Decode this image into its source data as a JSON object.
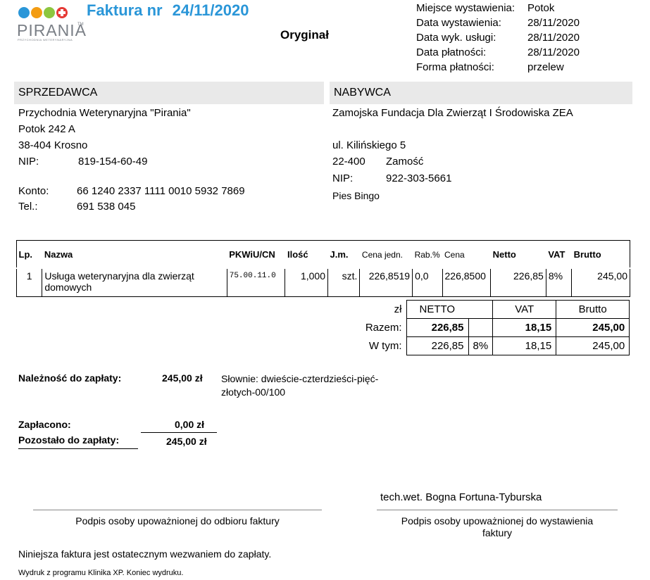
{
  "logo": {
    "word": "PIRANIA",
    "tm": "TM",
    "sub": "PRZYCHODNIA WETERYNARYJNA",
    "colors": [
      "#2a96d8",
      "#f39c12",
      "#8cc63f",
      "#e53935"
    ]
  },
  "header": {
    "title": "Faktura nr",
    "number": "24/11/2020",
    "copy_label": "Oryginał",
    "meta": [
      {
        "label": "Miejsce wystawienia:",
        "value": "Potok"
      },
      {
        "label": "Data wystawienia:",
        "value": "28/11/2020"
      },
      {
        "label": "Data wyk. usługi:",
        "value": "28/11/2020"
      },
      {
        "label": "Data płatności:",
        "value": "28/11/2020"
      },
      {
        "label": "Forma płatności:",
        "value": "przelew"
      }
    ]
  },
  "seller": {
    "heading": "SPRZEDAWCA",
    "name": "Przychodnia Weterynaryjna \"Pirania\"",
    "street": "Potok 242 A",
    "city": "38-404 Krosno",
    "nip_label": "NIP:",
    "nip": "819-154-60-49",
    "account_label": "Konto:",
    "account": "66 1240 2337 1111 0010 5932 7869",
    "phone_label": "Tel.:",
    "phone": "691 538 045"
  },
  "buyer": {
    "heading": "NABYWCA",
    "name": "Zamojska Fundacja Dla Zwierząt I Środowiska ZEA",
    "street": "ul. Kilińskiego 5",
    "postcode": "22-400",
    "city": "Zamość",
    "nip_label": "NIP:",
    "nip": "922-303-5661",
    "note": "Pies Bingo"
  },
  "items": {
    "headers": {
      "lp": "Lp.",
      "name": "Nazwa",
      "pkwiu": "PKWiU/CN",
      "qty": "Ilość",
      "unit": "J.m.",
      "unit_price": "Cena jedn.",
      "discount": "Rab.%",
      "price": "Cena",
      "net": "Netto",
      "vat": "VAT",
      "gross": "Brutto"
    },
    "rows": [
      {
        "lp": "1",
        "name": "Usługa weterynaryjna dla zwierząt domowych",
        "pkwiu": "75.00.11.0",
        "qty": "1,000",
        "unit": "szt.",
        "unit_price": "226,8519",
        "discount": "0,0",
        "price": "226,8500",
        "net": "226,85",
        "vat": "8%",
        "gross": "245,00"
      }
    ]
  },
  "summary": {
    "currency": "zł",
    "col_net": "NETTO",
    "col_vat": "VAT",
    "col_gross": "Brutto",
    "total_label": "Razem:",
    "total_net": "226,85",
    "total_vat": "18,15",
    "total_gross": "245,00",
    "breakdown_label": "W tym:",
    "breakdown_net": "226,85",
    "breakdown_rate": "8%",
    "breakdown_vat": "18,15",
    "breakdown_gross": "245,00"
  },
  "payment": {
    "due_label": "Należność do zapłaty:",
    "due_value": "245,00 zł",
    "words_line1": "Słownie: dwieście-czterdzieści-pięć-",
    "words_line2": "złotych-00/100",
    "paid_label": "Zapłacono:",
    "paid_value": "0,00 zł",
    "remaining_label": "Pozostało do zapłaty:",
    "remaining_value": "245,00 zł"
  },
  "signatures": {
    "issuer_name": "tech.wet. Bogna Fortuna-Tyburska",
    "receiver_caption": "Podpis osoby upoważnionej do odbioru faktury",
    "issuer_caption_line1": "Podpis osoby upoważnionej do wystawienia",
    "issuer_caption_line2": "faktury"
  },
  "footer": {
    "notice": "Niniejsza faktura jest ostatecznym wezwaniem do zapłaty.",
    "printout": "Wydruk z programu Klinika XP. Koniec wydruku."
  }
}
